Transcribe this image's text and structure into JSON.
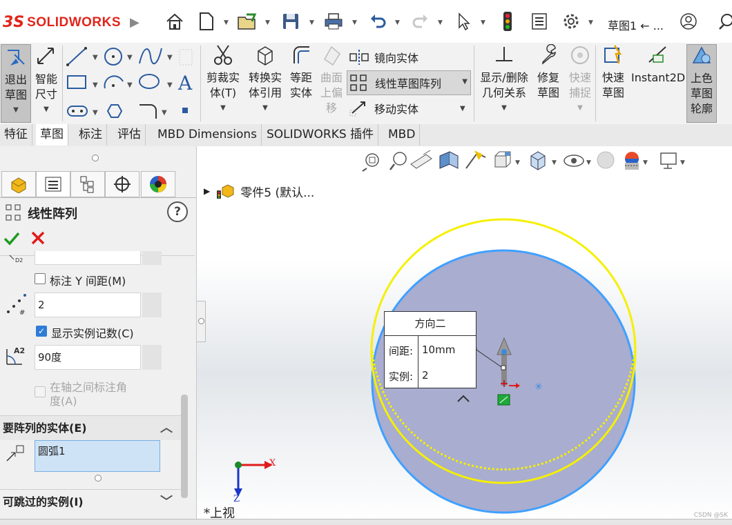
{
  "titlebar": {
    "logo_prefix": "3S",
    "logo_text": "SOLIDWORKS",
    "document_title": "草图1 ← ...",
    "icons": [
      "home-icon",
      "new-document-icon",
      "open-icon",
      "save-icon",
      "print-icon",
      "undo-icon",
      "redo-icon",
      "select-arrow-icon",
      "traffic-light-icon",
      "options-list-icon",
      "gear-icon",
      "user-icon",
      "search-icon"
    ]
  },
  "ribbon": {
    "exit_sketch": "退出草图",
    "smart_dimension": "智能尺寸",
    "trim": "剪裁实体(T)",
    "convert": "转换实体引用",
    "offset": "等距实体",
    "surface_offset": "曲面上偏移",
    "mirror": "镜向实体",
    "linear_pattern": "线性草图阵列",
    "move": "移动实体",
    "display_relations": "显示/删除几何关系",
    "repair": "修复草图",
    "rapid_snap": "快速捕捉",
    "rapid_sketch": "快速草图",
    "instant2d": "Instant2D",
    "shaded_contours": "上色草图轮廓"
  },
  "tabs": [
    "特征",
    "草图",
    "标注",
    "评估",
    "MBD Dimensions",
    "SOLIDWORKS 插件",
    "MBD"
  ],
  "active_tab": "草图",
  "property_manager": {
    "title": "线性阵列",
    "dim_y_spacing_label": "标注 Y 间距(M)",
    "instances_value": "2",
    "display_count_label": "显示实例记数(C)",
    "angle_value": "90度",
    "dim_between_axes_label_1": "在轴之间标注角",
    "dim_between_axes_label_2": "度(A)",
    "entities_section": "要阵列的实体(E)",
    "entity_item": "圆弧1",
    "skip_section": "可跳过的实例(I)"
  },
  "viewport": {
    "tree_item": "零件5 (默认...",
    "callout_title": "方向二",
    "spacing_label": "间距:",
    "spacing_value": "10mm",
    "instances_label": "实例:",
    "instances_value": "2",
    "view_name": "*上视",
    "axis_x": "X",
    "axis_z": "Z",
    "watermark": "CSDN @SK"
  },
  "colors": {
    "brand": "#e1251b",
    "yellow_circle": "#f5f000",
    "blue_circle": "#3fa0ff",
    "fill": "#a9adcf"
  }
}
